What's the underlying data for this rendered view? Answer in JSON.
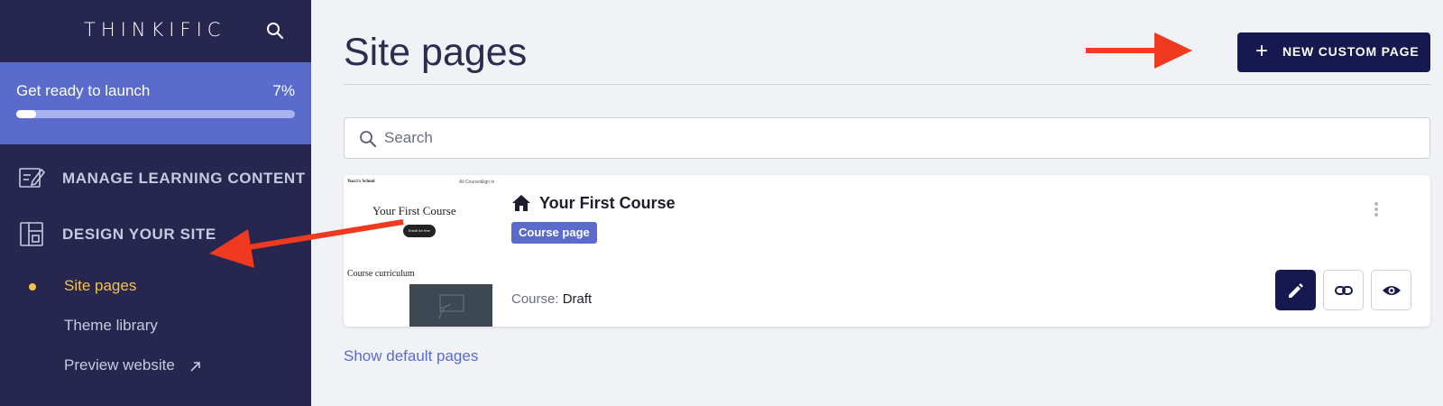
{
  "sidebar": {
    "logo": "THINKIFIC",
    "launch": {
      "title": "Get ready to launch",
      "percent_label": "7%",
      "progress": 0.07
    },
    "sections": [
      {
        "label": "MANAGE LEARNING CONTENT",
        "icon": "edit-content-icon"
      },
      {
        "label": "DESIGN YOUR SITE",
        "icon": "layout-icon"
      }
    ],
    "subitems": [
      {
        "label": "Site pages",
        "active": true
      },
      {
        "label": "Theme library",
        "active": false
      },
      {
        "label": "Preview website",
        "active": false,
        "icon": "external-arrow-icon"
      }
    ]
  },
  "main": {
    "title": "Site pages",
    "new_button_label": "NEW CUSTOM PAGE",
    "search_placeholder": "Search",
    "card": {
      "title": "Your First Course",
      "badge": "Course page",
      "status_label": "Course:",
      "status_value": "Draft",
      "thumbnail": {
        "school": "Yucci's School",
        "nav_courses": "All Courses",
        "nav_signin": "Sign in",
        "course_title": "Your First Course",
        "enroll": "Enroll for free",
        "curriculum": "Course curriculum"
      },
      "actions": [
        "pencil-icon",
        "link-icon",
        "eye-icon"
      ]
    },
    "show_default_link": "Show default pages"
  },
  "colors": {
    "sidebar": "#26264f",
    "launch_banner": "#5b6bcc",
    "active_nav": "#f5c447",
    "primary_button": "#17184f",
    "annotation_arrow": "#f03a1f"
  }
}
